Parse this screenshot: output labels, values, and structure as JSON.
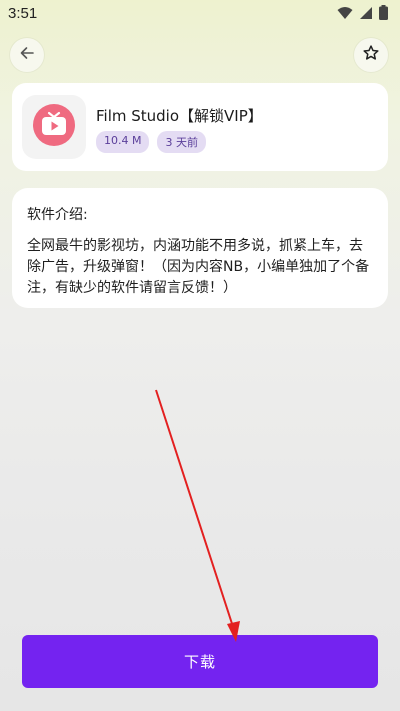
{
  "status_bar": {
    "time": "3:51",
    "icons": [
      "wifi-icon",
      "signal-icon",
      "battery-icon"
    ]
  },
  "top_bar": {
    "back_icon": "arrow-left-icon",
    "favorite_icon": "star-outline-icon"
  },
  "app": {
    "icon": "film-play-icon",
    "title": "Film Studio【解锁VIP】",
    "size": "10.4 M",
    "updated": "3 天前"
  },
  "description": {
    "heading": "软件介绍:",
    "body": "全网最牛的影视坊，内涵功能不用多说，抓紧上车，去除广告，升级弹窗！（因为内容NB，小编单独加了个备注，有缺少的软件请留言反馈！）"
  },
  "actions": {
    "download_label": "下载"
  },
  "colors": {
    "accent": "#7423f0",
    "tag_bg": "#e4dcf3",
    "tag_text": "#5a3e9a",
    "icon_pink": "#ef6a80",
    "annotation_arrow": "#e32020"
  }
}
